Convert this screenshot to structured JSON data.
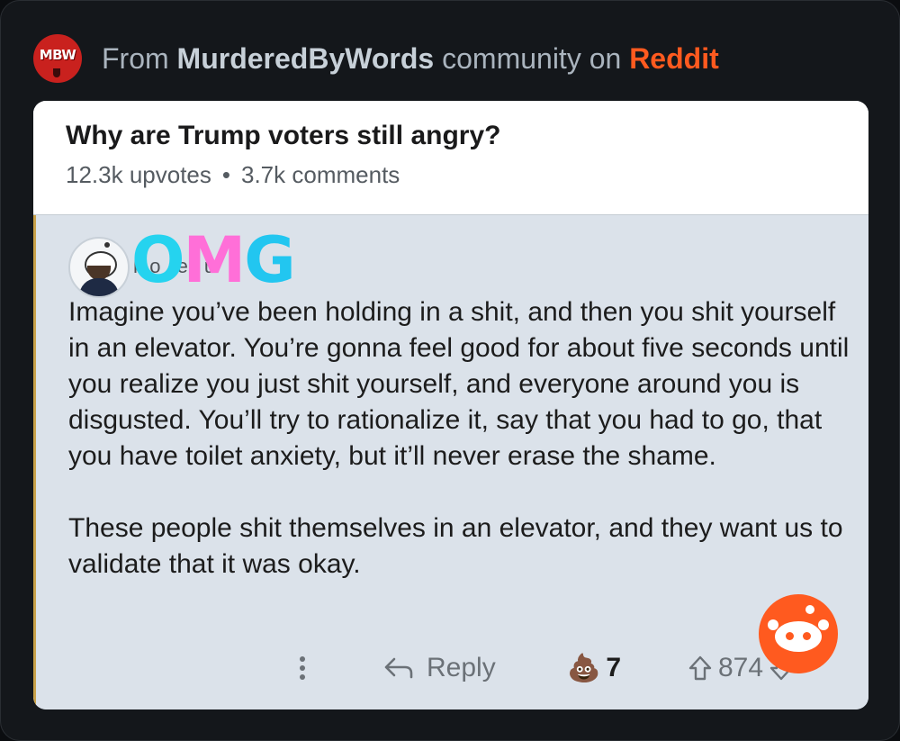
{
  "header": {
    "badge_text": "MBW",
    "prefix": "From",
    "community": "MurderedByWords",
    "middle": "community on",
    "platform": "Reddit"
  },
  "post": {
    "title": "Why are Trump voters still angry?",
    "upvotes": "12.3k upvotes",
    "separator": "•",
    "comments": "3.7k comments"
  },
  "comment": {
    "username_obscured": "ho   e   u",
    "sticker": {
      "o": "O",
      "m": "M",
      "g": "G"
    },
    "paragraphs": [
      "Imagine you’ve been holding in a shit, and then you shit yourself in an elevator. You’re gonna feel good for about five seconds until you realize you just shit yourself, and everyone around you is disgusted. You’ll try to rationalize it, say that you had to go, that you have toilet anxiety, but it’ll never erase the shame.",
      "These people shit themselves in an elevator, and they want us to validate that it was okay."
    ],
    "actions": {
      "reply_label": "Reply",
      "award_icon": "💩",
      "award_count": "7",
      "vote_count": "874"
    }
  },
  "colors": {
    "reddit_orange": "#ff5a1f",
    "badge_red": "#c9211e",
    "card_body": "#dbe2ea",
    "frame_bg": "#14171b"
  }
}
